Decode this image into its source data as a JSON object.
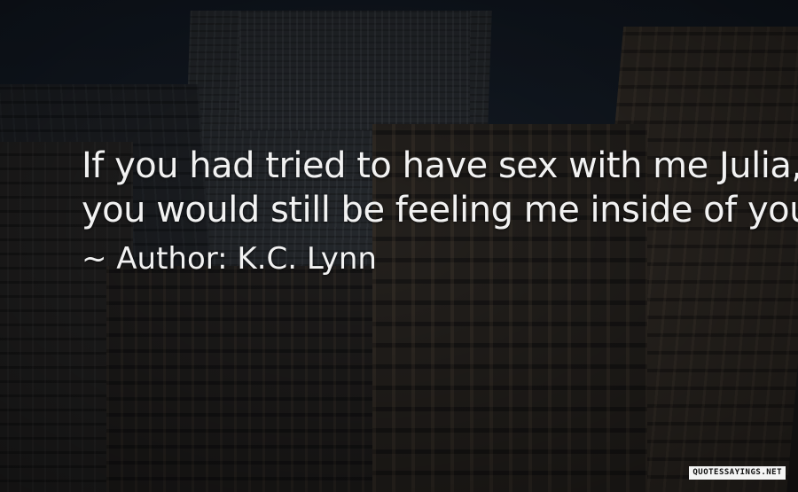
{
  "quote": {
    "lines": [
      "If you had tried to have sex with me Julia,",
      "you would still be feeling me inside of you."
    ],
    "attribution": "~ Author: K.C. Lynn"
  },
  "watermark": {
    "text": "QUOTESSAYINGS.NET"
  },
  "colors": {
    "quote_text": "#f2f2f2",
    "watermark_bg": "#f4f4f4"
  }
}
